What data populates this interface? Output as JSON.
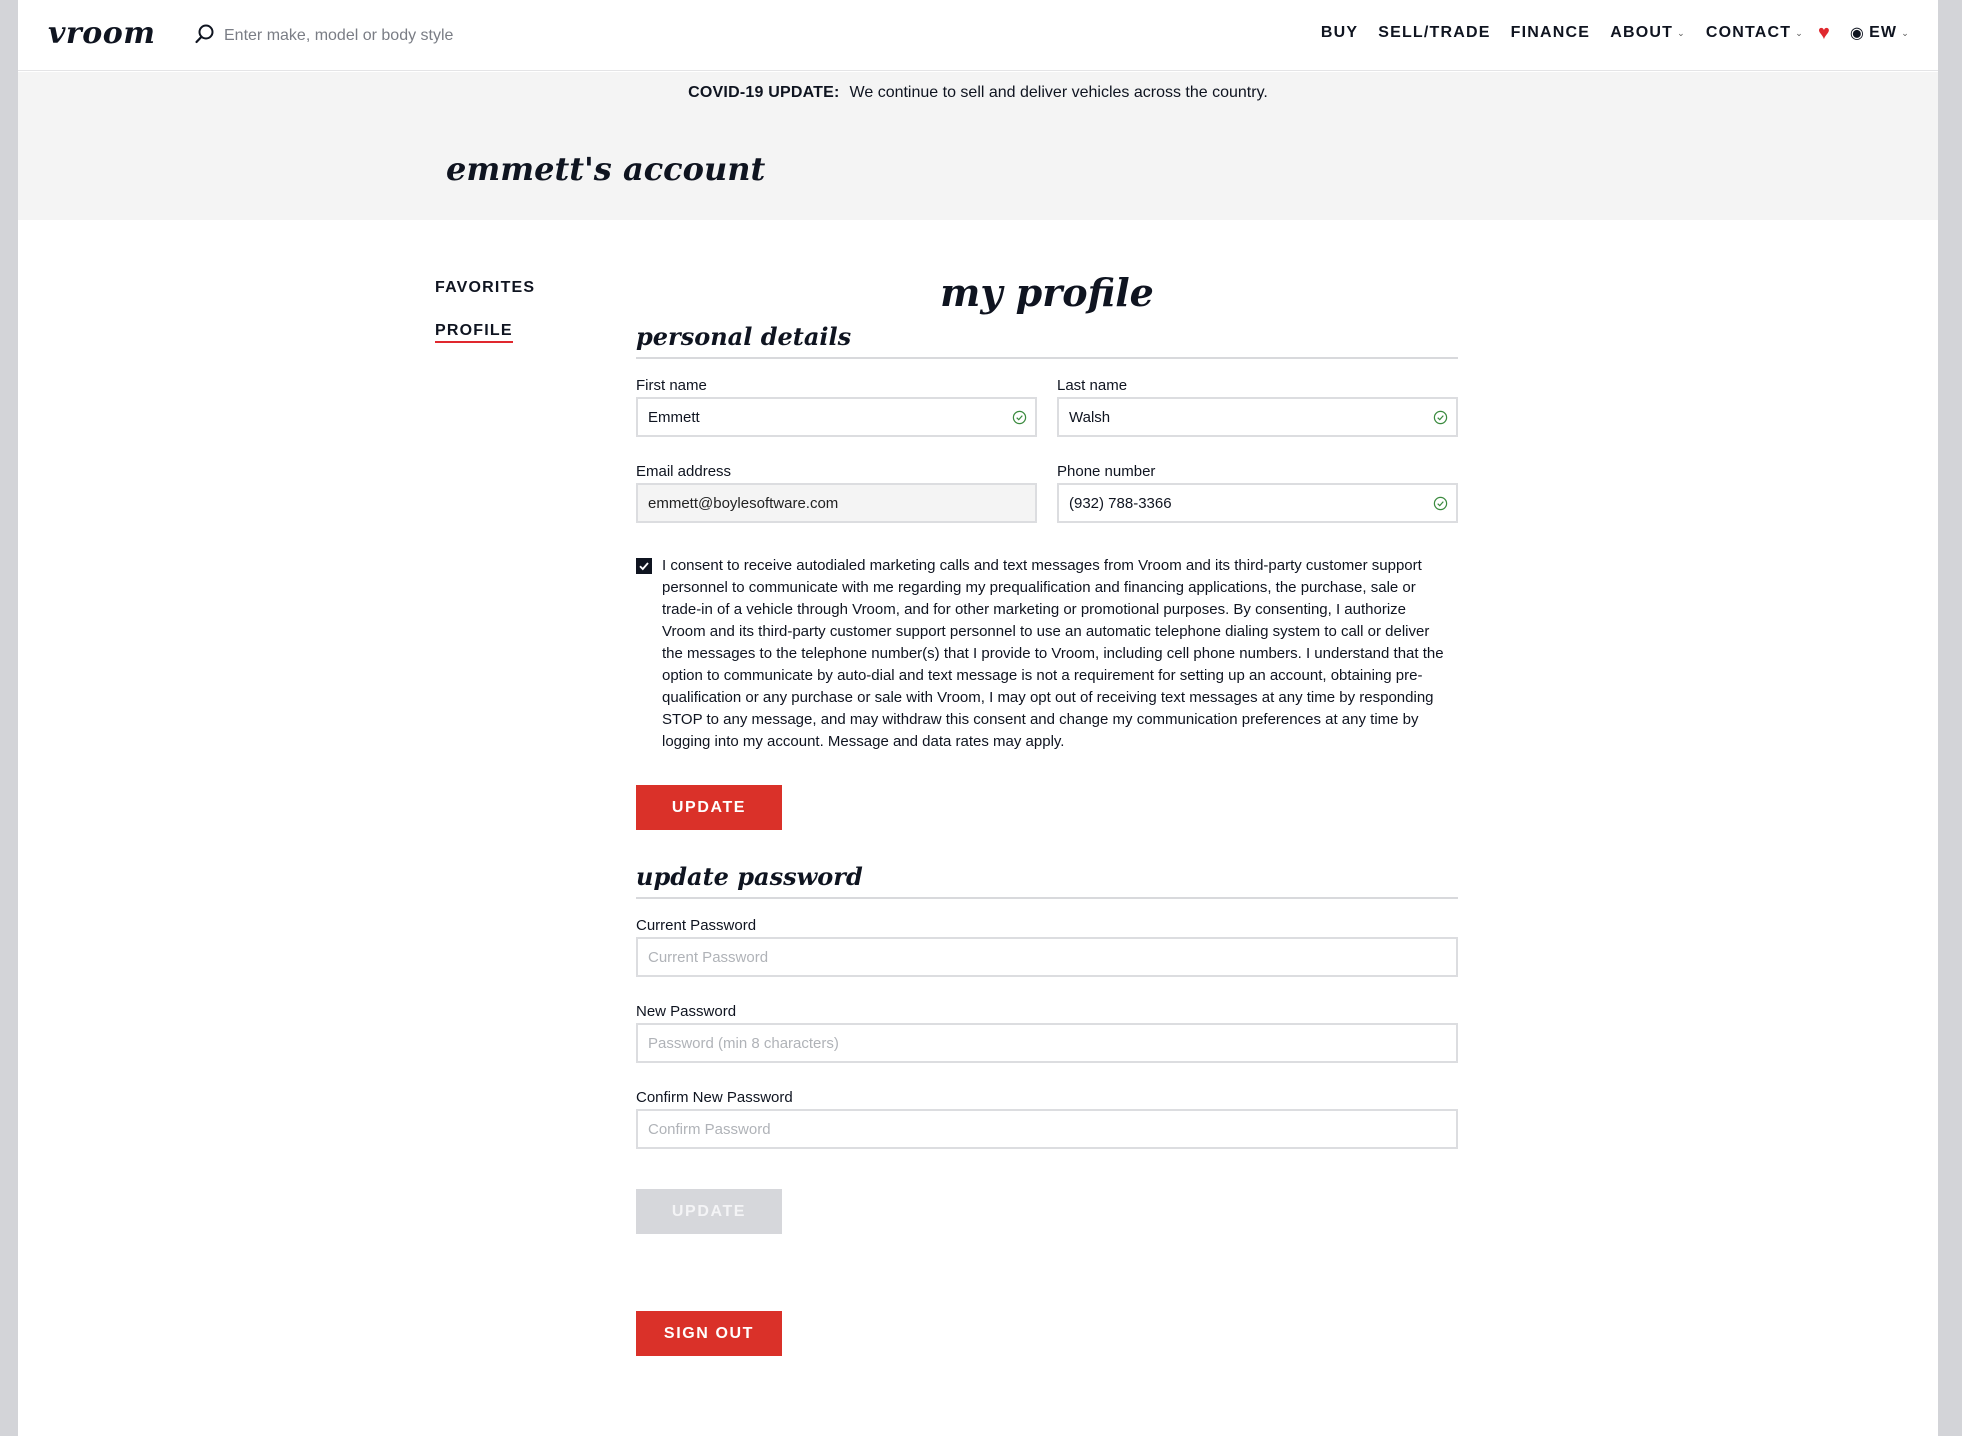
{
  "header": {
    "logo": "vroom",
    "search_placeholder": "Enter make, model or body style",
    "nav": {
      "buy": "BUY",
      "sell_trade": "SELL/TRADE",
      "finance": "FINANCE",
      "about": "ABOUT",
      "contact": "CONTACT",
      "user_initials": "EW"
    }
  },
  "banner": {
    "covid_label": "COVID-19 UPDATE:",
    "covid_message": "We continue to sell and deliver vehicles across the country.",
    "account_title": "emmett's account"
  },
  "sidebar": {
    "items": [
      {
        "label": "FAVORITES",
        "active": false
      },
      {
        "label": "PROFILE",
        "active": true
      }
    ]
  },
  "profile": {
    "title": "my profile",
    "personal_details": {
      "heading": "personal details",
      "first_name": {
        "label": "First name",
        "value": "Emmett"
      },
      "last_name": {
        "label": "Last name",
        "value": "Walsh"
      },
      "email": {
        "label": "Email address",
        "value": "emmett@boylesoftware.com"
      },
      "phone": {
        "label": "Phone number",
        "value": "(932) 788-3366"
      },
      "consent_checked": true,
      "consent_text": "I consent to receive autodialed marketing calls and text messages from Vroom and its third-party customer support personnel to communicate with me regarding my prequalification and financing applications, the purchase, sale or trade-in of a vehicle through Vroom, and for other marketing or promotional purposes. By consenting, I authorize Vroom and its third-party customer support personnel to use an automatic telephone dialing system to call or deliver the messages to the telephone number(s) that I provide to Vroom, including cell phone numbers. I understand that the option to communicate by auto-dial and text message is not a requirement for setting up an account, obtaining pre-qualification or any purchase or sale with Vroom, I may opt out of receiving text messages at any time by responding STOP to any message, and may withdraw this consent and change my communication preferences at any time by logging into my account. Message and data rates may apply.",
      "update_label": "UPDATE"
    },
    "password": {
      "heading": "update password",
      "current": {
        "label": "Current Password",
        "placeholder": "Current Password"
      },
      "new": {
        "label": "New Password",
        "placeholder": "Password (min 8 characters)"
      },
      "confirm": {
        "label": "Confirm New Password",
        "placeholder": "Confirm Password"
      },
      "update_label": "UPDATE"
    },
    "sign_out_label": "SIGN OUT"
  },
  "colors": {
    "brand_red": "#da3129",
    "heart_red": "#e0282e",
    "text_dark": "#0f1420",
    "success_green": "#3a8a3e",
    "disabled_gray": "#d6d7db"
  }
}
